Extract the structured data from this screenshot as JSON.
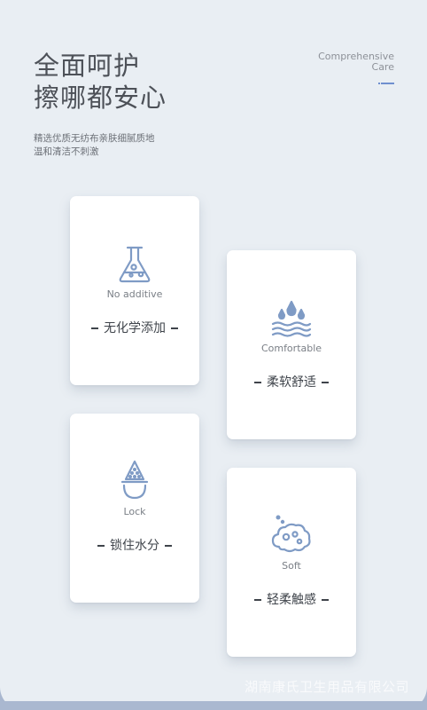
{
  "headline": {
    "line1": "全面呵护",
    "line2": "擦哪都安心"
  },
  "subtext": {
    "line1": "精选优质无纺布亲肤细腻质地",
    "line2": "温和清洁不刺激"
  },
  "english_title": {
    "line1": "Comprehensive",
    "line2": "Care"
  },
  "cards": [
    {
      "icon": "flask-icon",
      "label_en": "No additive",
      "label_cn": "无化学添加"
    },
    {
      "icon": "water-drops-waves-icon",
      "label_en": "Comfortable",
      "label_cn": "柔软舒适"
    },
    {
      "icon": "droplet-lock-icon",
      "label_en": "Lock",
      "label_cn": "锁住水分"
    },
    {
      "icon": "soft-cloud-icon",
      "label_en": "Soft",
      "label_cn": "轻柔触感"
    }
  ],
  "watermark": "湖南康氏卫生用品有限公司",
  "colors": {
    "background": "#e9eef3",
    "card": "#ffffff",
    "accent": "#6f8fcf",
    "icon_stroke": "#7f9bc5",
    "heading_text": "#4d5158",
    "body_text": "#6d7178"
  }
}
